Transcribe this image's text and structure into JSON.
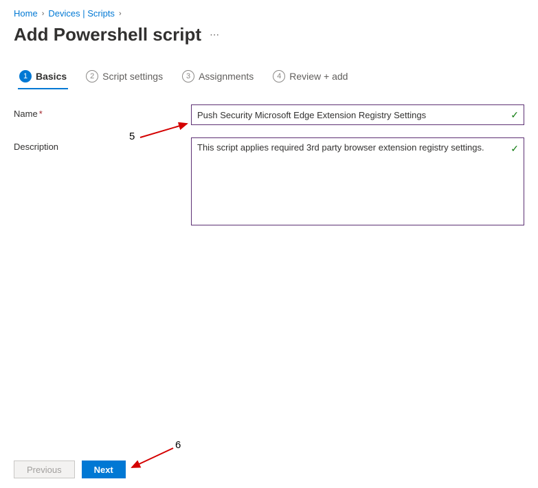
{
  "breadcrumb": {
    "home": "Home",
    "devices": "Devices | Scripts"
  },
  "page_title": "Add Powershell script",
  "tabs": [
    {
      "num": "1",
      "label": "Basics"
    },
    {
      "num": "2",
      "label": "Script settings"
    },
    {
      "num": "3",
      "label": "Assignments"
    },
    {
      "num": "4",
      "label": "Review + add"
    }
  ],
  "form": {
    "name_label": "Name",
    "name_value": "Push Security Microsoft Edge Extension Registry Settings",
    "desc_label": "Description",
    "desc_value": "This script applies required 3rd party browser extension registry settings."
  },
  "annotations": {
    "a5": "5",
    "a6": "6"
  },
  "buttons": {
    "previous": "Previous",
    "next": "Next"
  },
  "colors": {
    "primary": "#0078d4",
    "fieldBorder": "#5b2e72",
    "success": "#107c10"
  }
}
